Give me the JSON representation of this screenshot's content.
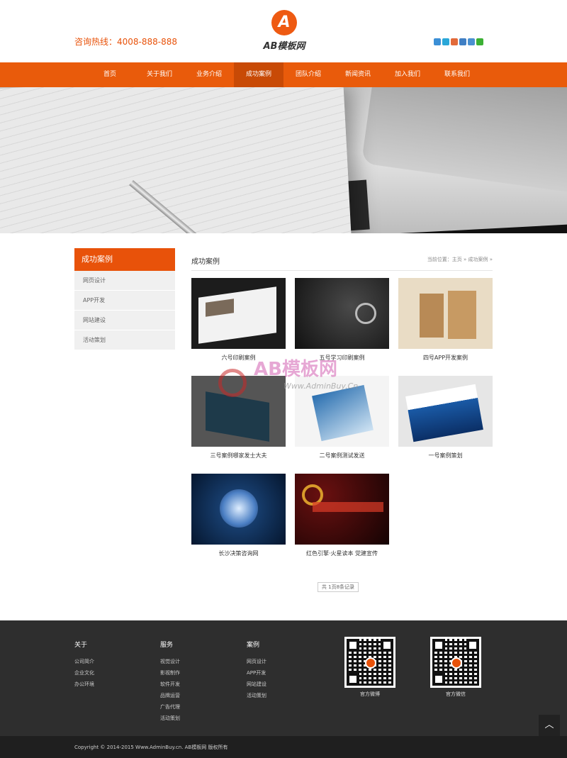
{
  "header": {
    "hotline": "咨询热线：4008-888-888",
    "logo_mark": "A",
    "logo_text": "AB模板网"
  },
  "social_icons": [
    "weibo-icon",
    "qzone-icon",
    "tqq-icon",
    "renren-icon",
    "kaixin-icon",
    "wechat-icon"
  ],
  "nav": {
    "items": [
      "首页",
      "关于我们",
      "业务介绍",
      "成功案例",
      "团队介绍",
      "新闻资讯",
      "加入我们",
      "联系我们"
    ],
    "active": "成功案例",
    "bg_color": "#e95b0b"
  },
  "sidebar": {
    "title": "成功案例",
    "items": [
      "网页设计",
      "APP开发",
      "网站建设",
      "活动策划"
    ]
  },
  "main": {
    "title": "成功案例",
    "breadcrumb": "当前位置：主页 » 成功案例 »",
    "cases": [
      {
        "caption": "六号印刷案例"
      },
      {
        "caption": "五号学习印刷案例"
      },
      {
        "caption": "四号APP开发案例"
      },
      {
        "caption": "三号案例哪家发士大夫"
      },
      {
        "caption": "二号案例测试发送"
      },
      {
        "caption": "一号案例策划"
      },
      {
        "caption": "长沙决策咨询网"
      },
      {
        "caption": "红色引擎·火星读本 党建宣传"
      }
    ],
    "pager": "共 1页8条记录"
  },
  "watermark": {
    "text": "AB模板网",
    "sub": "Www.AdminBuy.Cn"
  },
  "footer": {
    "cols": [
      {
        "title": "关于",
        "links": [
          "公司简介",
          "企业文化",
          "办公环境"
        ]
      },
      {
        "title": "服务",
        "links": [
          "视觉设计",
          "影视制作",
          "软件开发",
          "品牌运营",
          "广告代理",
          "活动策划"
        ]
      },
      {
        "title": "案例",
        "links": [
          "网页设计",
          "APP开发",
          "网站建设",
          "活动策划"
        ]
      }
    ],
    "qr": [
      {
        "caption": "官方微博"
      },
      {
        "caption": "官方微信"
      }
    ],
    "totop": "︿",
    "copyright": "Copyright © 2014-2015 Www.AdminBuy.cn. AB模板网 版权所有"
  }
}
